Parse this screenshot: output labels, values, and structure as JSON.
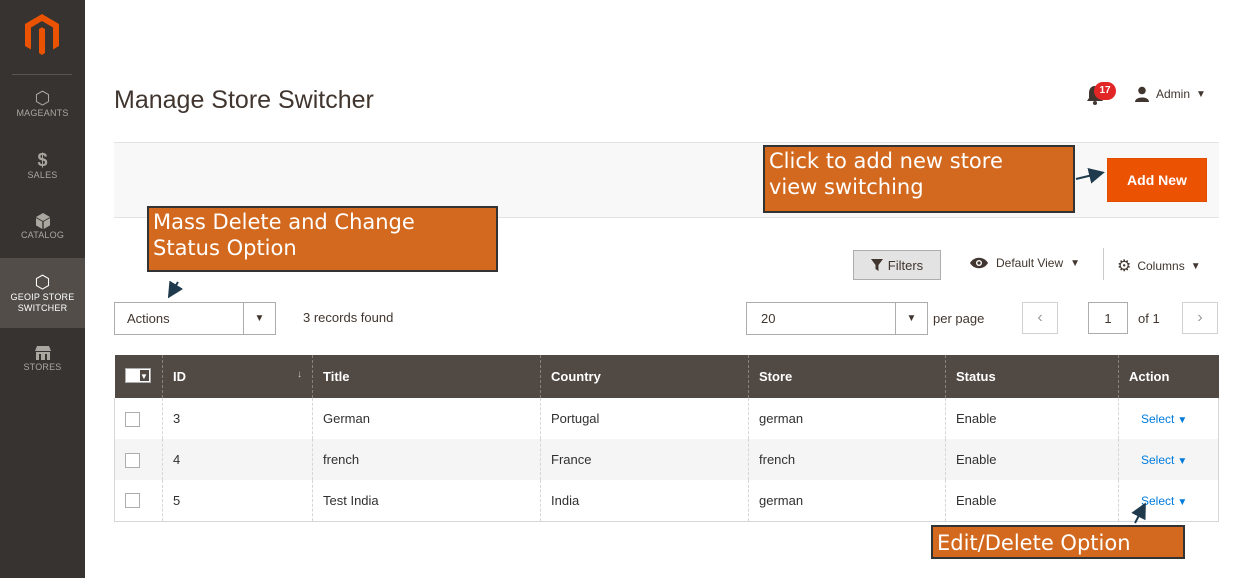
{
  "sidebar": {
    "items": [
      {
        "label": "MAGEANTS",
        "icon": "hexagon-icon"
      },
      {
        "label": "SALES",
        "icon": "dollar-icon"
      },
      {
        "label": "CATALOG",
        "icon": "cube-icon"
      },
      {
        "label": "GEOIP STORE SWITCHER",
        "label_line1": "GEOIP STORE",
        "label_line2": "SWITCHER",
        "icon": "hexagon-icon",
        "active": true
      },
      {
        "label": "STORES",
        "icon": "store-icon"
      }
    ]
  },
  "header": {
    "title": "Manage Store Switcher",
    "notifications_count": "17",
    "user_label": "Admin"
  },
  "action_bar": {
    "add_new_label": "Add New"
  },
  "annotations": {
    "add_new": "Click to add new store view switching",
    "add_new_line1": "Click to add new store",
    "add_new_line2": "view switching",
    "mass_actions": "Mass Delete and Change Status Option",
    "mass_line1": "Mass Delete and Change",
    "mass_line2": "Status Option",
    "edit_delete": "Edit/Delete Option"
  },
  "toolbar": {
    "filters_label": "Filters",
    "view_label": "Default View",
    "columns_label": "Columns",
    "actions_label": "Actions",
    "records_found": "3 records found",
    "per_page_value": "20",
    "per_page_label": "per page",
    "current_page": "1",
    "total_pages_label": "of 1",
    "prev_symbol": "‹",
    "next_symbol": "›"
  },
  "grid": {
    "columns": [
      "ID",
      "Title",
      "Country",
      "Store",
      "Status",
      "Action"
    ],
    "sort_indicator": "↓",
    "rows": [
      {
        "id": "3",
        "title": "German",
        "country": "Portugal",
        "store": "german",
        "status": "Enable",
        "action": "Select"
      },
      {
        "id": "4",
        "title": "french",
        "country": "France",
        "store": "french",
        "status": "Enable",
        "action": "Select"
      },
      {
        "id": "5",
        "title": "Test India",
        "country": "India",
        "store": "german",
        "status": "Enable",
        "action": "Select"
      }
    ]
  },
  "colors": {
    "sidebar_bg": "#373330",
    "accent_orange": "#eb5202",
    "table_header": "#514943",
    "link_blue": "#007bdb",
    "callout_bg": "#d2691e",
    "badge_red": "#e22626"
  }
}
